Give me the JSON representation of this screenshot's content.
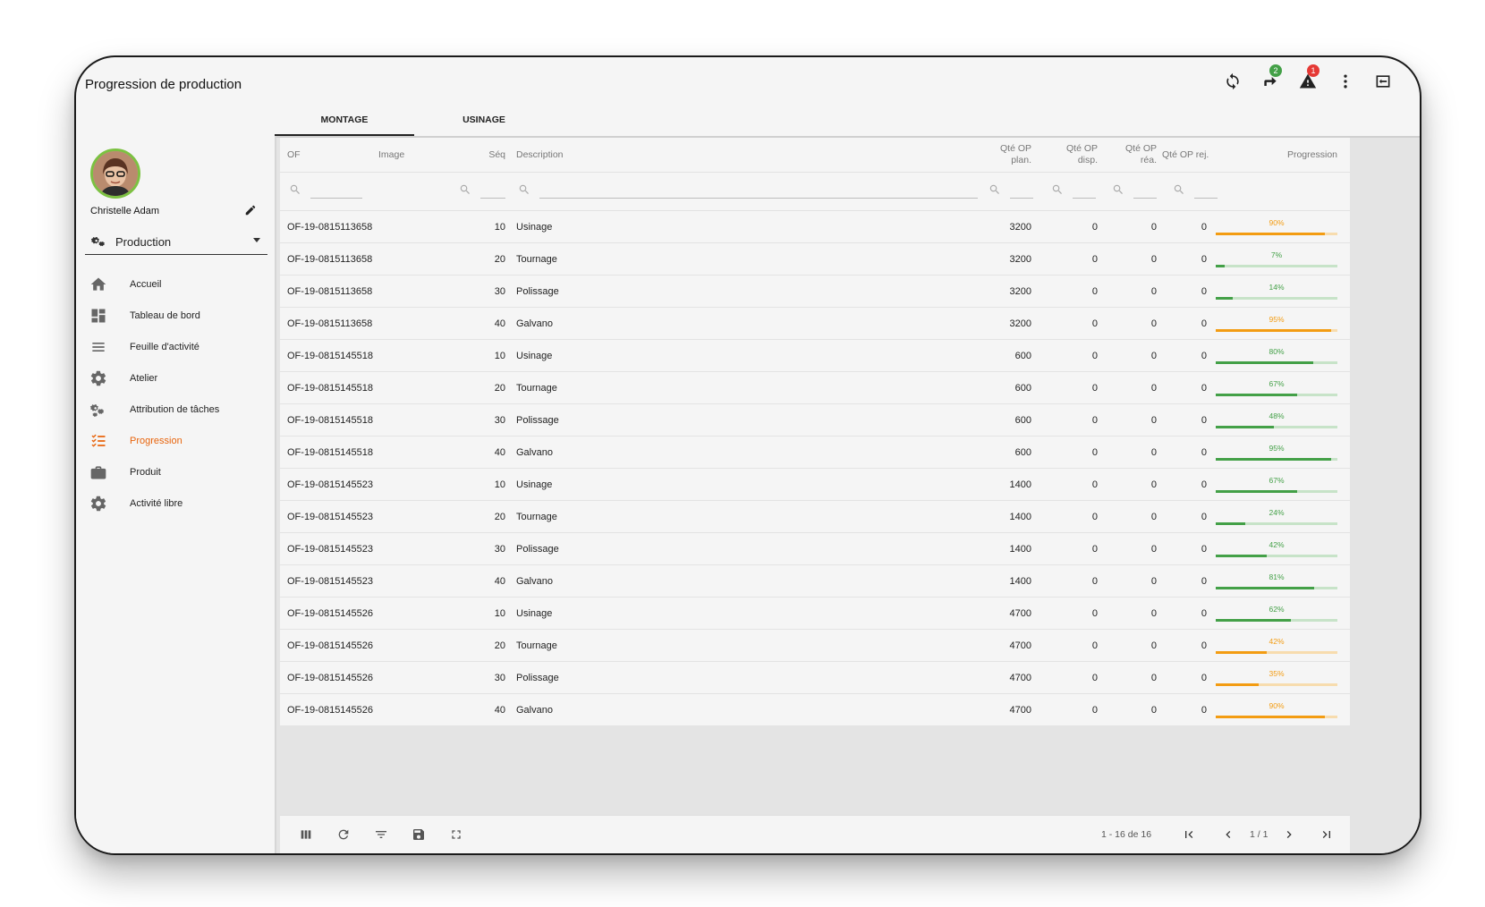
{
  "app": {
    "title": "Progression de production",
    "notifications": {
      "messages_count": "2",
      "alerts_count": "1"
    }
  },
  "tabs": [
    {
      "label": "MONTAGE",
      "active": true
    },
    {
      "label": "USINAGE",
      "active": false
    }
  ],
  "user": {
    "name": "Christelle Adam"
  },
  "profile": {
    "selected": "Production"
  },
  "nav": [
    {
      "label": "Accueil",
      "icon": "home-icon",
      "active": false
    },
    {
      "label": "Tableau de bord",
      "icon": "dashboard-icon",
      "active": false
    },
    {
      "label": "Feuille d'activité",
      "icon": "list-icon",
      "active": false
    },
    {
      "label": "Atelier",
      "icon": "gear-icon",
      "active": false
    },
    {
      "label": "Attribution de tâches",
      "icon": "gears-icon",
      "active": false
    },
    {
      "label": "Progression",
      "icon": "checklist-icon",
      "active": true
    },
    {
      "label": "Produit",
      "icon": "briefcase-icon",
      "active": false
    },
    {
      "label": "Activité libre",
      "icon": "gear-icon",
      "active": false
    }
  ],
  "table": {
    "columns": {
      "of": "OF",
      "image": "Image",
      "seq": "Séq",
      "description": "Description",
      "qte_plan": "Qté OP plan.",
      "qte_disp": "Qté OP disp.",
      "qte_rea": "Qté OP réa.",
      "qte_rej": "Qté OP rej.",
      "progression": "Progression"
    },
    "rows": [
      {
        "of": "OF-19-0815113658",
        "seq": "10",
        "description": "Usinage",
        "plan": "3200",
        "disp": "0",
        "rea": "0",
        "rej": "0",
        "progress": 90,
        "label": "90%",
        "color": "#f39c12"
      },
      {
        "of": "OF-19-0815113658",
        "seq": "20",
        "description": "Tournage",
        "plan": "3200",
        "disp": "0",
        "rea": "0",
        "rej": "0",
        "progress": 7,
        "label": "7%",
        "color": "#43a047"
      },
      {
        "of": "OF-19-0815113658",
        "seq": "30",
        "description": "Polissage",
        "plan": "3200",
        "disp": "0",
        "rea": "0",
        "rej": "0",
        "progress": 14,
        "label": "14%",
        "color": "#43a047"
      },
      {
        "of": "OF-19-0815113658",
        "seq": "40",
        "description": "Galvano",
        "plan": "3200",
        "disp": "0",
        "rea": "0",
        "rej": "0",
        "progress": 95,
        "label": "95%",
        "color": "#f39c12"
      },
      {
        "of": "OF-19-0815145518",
        "seq": "10",
        "description": "Usinage",
        "plan": "600",
        "disp": "0",
        "rea": "0",
        "rej": "0",
        "progress": 80,
        "label": "80%",
        "color": "#43a047"
      },
      {
        "of": "OF-19-0815145518",
        "seq": "20",
        "description": "Tournage",
        "plan": "600",
        "disp": "0",
        "rea": "0",
        "rej": "0",
        "progress": 67,
        "label": "67%",
        "color": "#43a047"
      },
      {
        "of": "OF-19-0815145518",
        "seq": "30",
        "description": "Polissage",
        "plan": "600",
        "disp": "0",
        "rea": "0",
        "rej": "0",
        "progress": 48,
        "label": "48%",
        "color": "#43a047"
      },
      {
        "of": "OF-19-0815145518",
        "seq": "40",
        "description": "Galvano",
        "plan": "600",
        "disp": "0",
        "rea": "0",
        "rej": "0",
        "progress": 95,
        "label": "95%",
        "color": "#43a047"
      },
      {
        "of": "OF-19-0815145523",
        "seq": "10",
        "description": "Usinage",
        "plan": "1400",
        "disp": "0",
        "rea": "0",
        "rej": "0",
        "progress": 67,
        "label": "67%",
        "color": "#43a047"
      },
      {
        "of": "OF-19-0815145523",
        "seq": "20",
        "description": "Tournage",
        "plan": "1400",
        "disp": "0",
        "rea": "0",
        "rej": "0",
        "progress": 24,
        "label": "24%",
        "color": "#43a047"
      },
      {
        "of": "OF-19-0815145523",
        "seq": "30",
        "description": "Polissage",
        "plan": "1400",
        "disp": "0",
        "rea": "0",
        "rej": "0",
        "progress": 42,
        "label": "42%",
        "color": "#43a047"
      },
      {
        "of": "OF-19-0815145523",
        "seq": "40",
        "description": "Galvano",
        "plan": "1400",
        "disp": "0",
        "rea": "0",
        "rej": "0",
        "progress": 81,
        "label": "81%",
        "color": "#43a047"
      },
      {
        "of": "OF-19-0815145526",
        "seq": "10",
        "description": "Usinage",
        "plan": "4700",
        "disp": "0",
        "rea": "0",
        "rej": "0",
        "progress": 62,
        "label": "62%",
        "color": "#43a047"
      },
      {
        "of": "OF-19-0815145526",
        "seq": "20",
        "description": "Tournage",
        "plan": "4700",
        "disp": "0",
        "rea": "0",
        "rej": "0",
        "progress": 42,
        "label": "42%",
        "color": "#f39c12"
      },
      {
        "of": "OF-19-0815145526",
        "seq": "30",
        "description": "Polissage",
        "plan": "4700",
        "disp": "0",
        "rea": "0",
        "rej": "0",
        "progress": 35,
        "label": "35%",
        "color": "#f39c12"
      },
      {
        "of": "OF-19-0815145526",
        "seq": "40",
        "description": "Galvano",
        "plan": "4700",
        "disp": "0",
        "rea": "0",
        "rej": "0",
        "progress": 90,
        "label": "90%",
        "color": "#f39c12"
      }
    ]
  },
  "pager": {
    "range": "1 - 16 de 16",
    "page": "1 / 1"
  },
  "colors": {
    "accent": "#e8640c",
    "progress_green": "#43a047",
    "progress_orange": "#f39c12",
    "avatar_ring": "#7cc142"
  }
}
